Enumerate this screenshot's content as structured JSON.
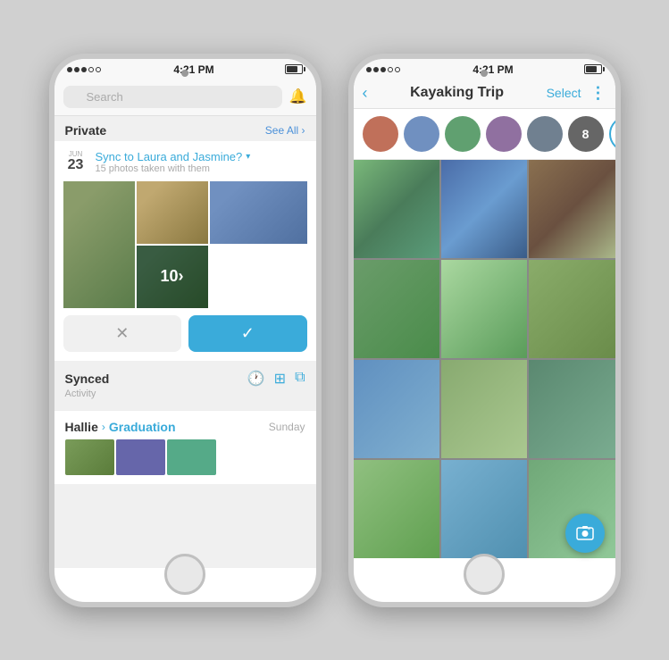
{
  "phone1": {
    "status": {
      "dots": [
        "filled",
        "filled",
        "filled",
        "empty",
        "empty"
      ],
      "time": "4:21 PM",
      "signal": "●●●"
    },
    "search": {
      "placeholder": "Search"
    },
    "private_section": {
      "title": "Private",
      "see_all": "See All ›"
    },
    "sync_card": {
      "month": "JUN",
      "day": "23",
      "title": "Sync to Laura and Jasmine?",
      "subtitle": "15 photos taken with them",
      "dismiss_label": "✕",
      "accept_label": "✓",
      "count_overlay": "10›"
    },
    "synced_section": {
      "title": "Synced",
      "subtitle": "Activity"
    },
    "album": {
      "from": "Hallie",
      "arrow": "›",
      "name": "Graduation",
      "date": "Sunday"
    }
  },
  "phone2": {
    "status": {
      "time": "4:21 PM"
    },
    "nav": {
      "back": "‹",
      "title": "Kayaking Trip",
      "select": "Select",
      "more": "⋮"
    },
    "avatars": {
      "count_label": "8",
      "add_label": "+"
    },
    "fab": {
      "icon": "🖼"
    }
  }
}
